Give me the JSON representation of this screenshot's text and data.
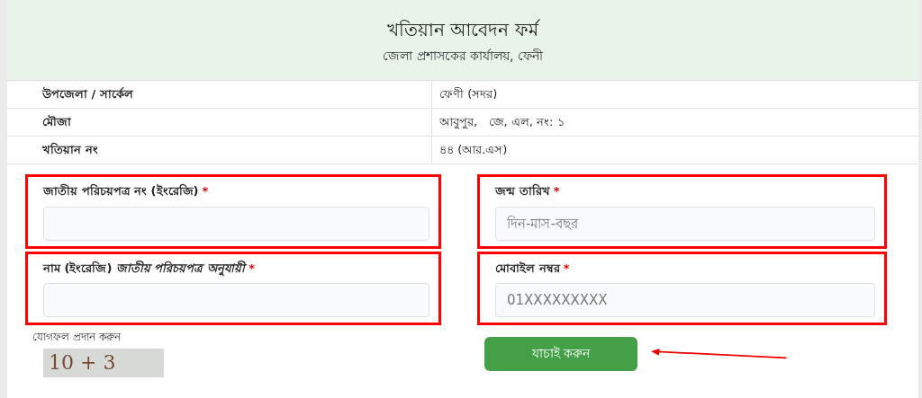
{
  "header": {
    "title": "খতিয়ান আবেদন ফর্ম",
    "subtitle": "জেলা প্রশাসকের কার্যালয়, ফেনী"
  },
  "info_rows": [
    {
      "label": "উপজেলা / সার্কেল",
      "value": "ফেণী (সদর)"
    },
    {
      "label": "মৌজা",
      "value": "আবুপুর,   জে, এল, নং: ১"
    },
    {
      "label": "খতিয়ান নং",
      "value": "৪৪ (আর.এস)"
    }
  ],
  "left_fields": [
    {
      "label": "জাতীয় পরিচয়পত্র নং (ইংরেজি)",
      "required_mark": "*"
    },
    {
      "label": "নাম (ইংরেজি) *জাতীয় পরিচয়পত্র অনুযায়ী*",
      "required_mark": "*"
    }
  ],
  "right_fields": [
    {
      "label": "জন্ম তারিখ",
      "required_mark": "*",
      "placeholder": "দিন-মাস-বছর"
    },
    {
      "label": "মোবাইল নম্বর",
      "required_mark": "*",
      "placeholder": "01XXXXXXXXX"
    }
  ],
  "captcha": {
    "prompt": "যোগফল প্রদান করুন",
    "image_text": "10 + 3"
  },
  "submit_button": "যাচাই করুন"
}
